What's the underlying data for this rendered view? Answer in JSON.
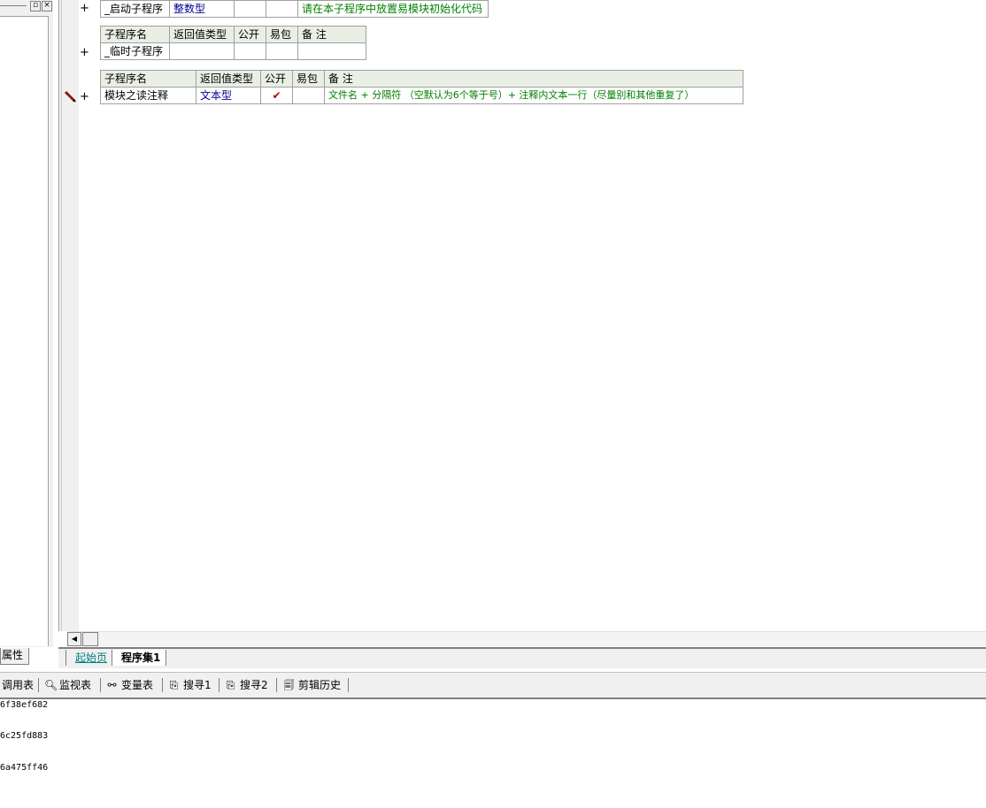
{
  "left_panel": {
    "restore_glyph": "▫",
    "close_glyph": "×",
    "properties_tab": "属性"
  },
  "tables": {
    "row_startup": {
      "name": "_启动子程序",
      "return_type": "整数型",
      "public": "",
      "easy_pkg": "",
      "remark": "请在本子程序中放置易模块初始化代码"
    },
    "table_temp": {
      "headers": [
        "子程序名",
        "返回值类型",
        "公开",
        "易包",
        "备 注"
      ],
      "row": {
        "name": "_临时子程序",
        "return_type": "",
        "public": "",
        "easy_pkg": "",
        "remark": ""
      }
    },
    "table_module": {
      "headers": [
        "子程序名",
        "返回值类型",
        "公开",
        "易包",
        "备 注"
      ],
      "row": {
        "name": "模块之读注释",
        "return_type": "文本型",
        "public_check": "✔",
        "easy_pkg": "",
        "remark": "文件名  +  分隔符 （空默认为6个等于号）+ 注释内文本一行（尽量别和其他重复了）"
      }
    },
    "expand_glyph": "+"
  },
  "tabs": {
    "start_page": "起始页",
    "program_set": "程序集1"
  },
  "toolbar": {
    "call_table": "调用表",
    "watch_table": "监视表",
    "variable_table": "变量表",
    "search1": "搜寻1",
    "search2": "搜寻2",
    "clip_history": "剪辑历史"
  },
  "output": {
    "lines": [
      "6f38ef682",
      "6c25fd883",
      "6a475ff46"
    ]
  },
  "colors": {
    "header_bg": "#e9efe4",
    "type_blue": "#000099",
    "remark_green": "#008000",
    "link_teal": "#008080"
  }
}
